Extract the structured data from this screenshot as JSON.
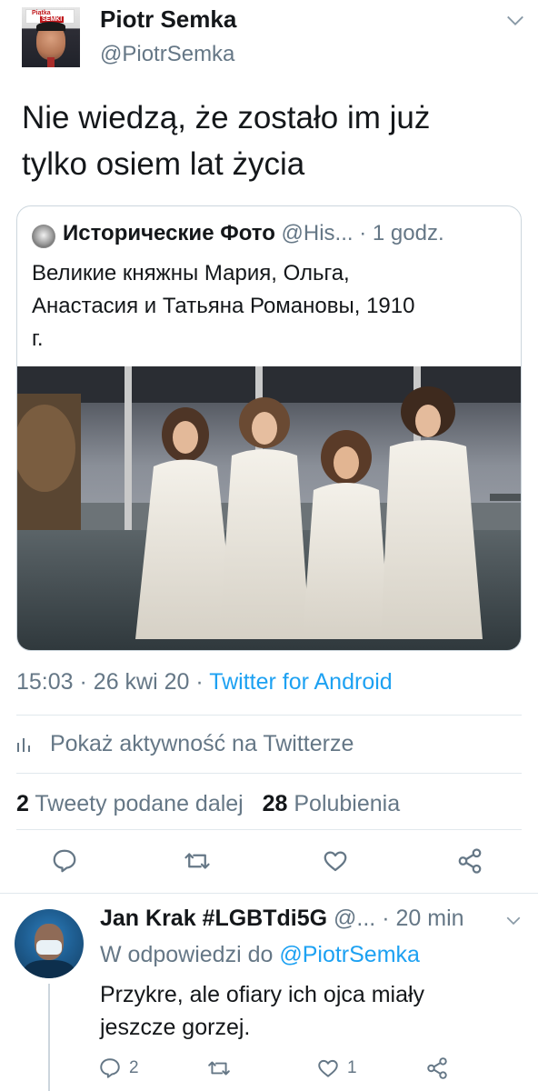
{
  "tweet": {
    "author_name": "Piotr Semka",
    "author_handle": "@PiotrSemka",
    "avatar_logo_line1": "Piątka",
    "avatar_logo_line2": "SEMKI",
    "text_line1": "Nie wiedzą, że zostało im już",
    "text_line2": "tylko osiem lat życia",
    "time": "15:03",
    "date": "26 kwi 20",
    "source": "Twitter for Android",
    "activity_label": "Pokaż aktywność na Twitterze",
    "retweets_count": "2",
    "retweets_label": "Tweety podane dalej",
    "likes_count": "28",
    "likes_label": "Polubienia"
  },
  "quoted": {
    "name": "Исторические Фото",
    "handle": "@His...",
    "time": "1 godz.",
    "text_line1": "Великие княжны Мария, Ольга,",
    "text_line2": "Анастасия и Татьяна Романовы, 1910",
    "text_line3": "г."
  },
  "reply": {
    "name": "Jan Krak #LGBTdi5G",
    "handle": "@...",
    "time": "20 min",
    "reply_to_label": "W odpowiedzi do",
    "reply_to_mention": "@PiotrSemka",
    "text_line1": "Przykre, ale ofiary ich ojca miały",
    "text_line2": "jeszcze gorzej.",
    "reply_count": "2",
    "like_count": "1"
  },
  "separators": {
    "dot": "·"
  },
  "colors": {
    "text": "#14171a",
    "secondary": "#657786",
    "accent": "#1da1f2",
    "divider": "#e1e8ed"
  },
  "icons": [
    "caret-down-icon",
    "bar-chart-icon",
    "reply-icon",
    "retweet-icon",
    "like-icon",
    "share-icon"
  ]
}
